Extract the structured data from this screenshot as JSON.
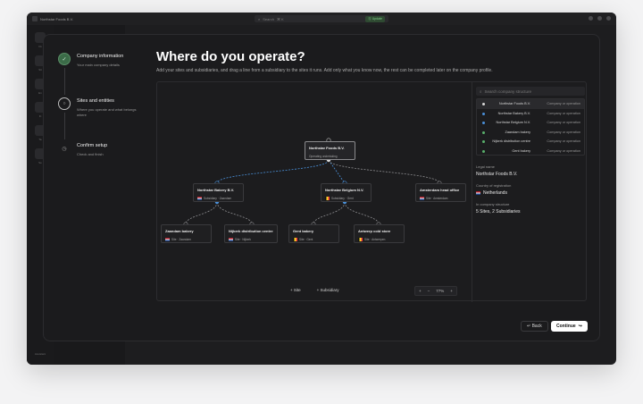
{
  "topbar": {
    "org_name": "Northstar Foods B.V.",
    "search_placeholder": "Search",
    "shortcut": "⌘ K",
    "badge": "Ⓢ Update"
  },
  "rail": {
    "items": [
      "Ov",
      "Sit",
      "En",
      "Fi",
      "Ta",
      "Se"
    ],
    "bottom_label": "Assistant"
  },
  "steps": [
    {
      "title": "Company information",
      "sub": "Your main company details",
      "state": "done",
      "marker": "✓"
    },
    {
      "title": "Sites and entities",
      "sub": "Where you operate and what belongs where",
      "state": "current",
      "marker": "○"
    },
    {
      "title": "Confirm setup",
      "sub": "Check and finish",
      "state": "todo",
      "marker": "◷"
    }
  ],
  "heading": "Where do you operate?",
  "description": "Add your sites and subsidiaries, and drag a line from a subsidiary to the sites it runs. Add only what you know now, the rest can be completed later on the company profile.",
  "nodes": {
    "root": {
      "name": "Northstar Foods B.V.",
      "meta": "Operating undertaking"
    },
    "sub1": {
      "name": "Northstar Bakery B.V.",
      "meta": "Subsidiary · Zaandam",
      "flag": "nl"
    },
    "sub2": {
      "name": "Northstar Belgium N.V.",
      "meta": "Subsidiary · Gent",
      "flag": "be"
    },
    "hq": {
      "name": "Amsterdam head office",
      "meta": "Site · Amsterdam",
      "flag": "nl"
    },
    "site1": {
      "name": "Zaandam bakery",
      "meta": "Site · Zaandam",
      "flag": "nl"
    },
    "site2": {
      "name": "Nijkerk distribution centre",
      "meta": "Site · Nijkerk",
      "flag": "nl"
    },
    "site3": {
      "name": "Gent bakery",
      "meta": "Site · Gent",
      "flag": "be"
    },
    "site4": {
      "name": "Antwerp cold store",
      "meta": "Site · Antwerpen",
      "flag": "be"
    }
  },
  "canvas_tools": {
    "add_site": "+ Site",
    "add_subsidiary": "+ Subsidiary"
  },
  "zoom": {
    "plus": "+",
    "minus": "−",
    "level": "77%",
    "fit": "+"
  },
  "side": {
    "search_placeholder": "Search company structure",
    "list": [
      {
        "name": "Northstar Foods B.V.",
        "type": "Company or operation",
        "dot": "#d8d8d8",
        "selected": true
      },
      {
        "name": "Northstar Bakery B.V.",
        "type": "Company or operation",
        "dot": "#4a90d9",
        "selected": false
      },
      {
        "name": "Northstar Belgium N.V.",
        "type": "Company or operation",
        "dot": "#4a90d9",
        "selected": false
      },
      {
        "name": "Zaandam bakery",
        "type": "Company or operation",
        "dot": "#59b06b",
        "selected": false
      },
      {
        "name": "Nijkerk distribution centre",
        "type": "Company or operation",
        "dot": "#59b06b",
        "selected": false
      },
      {
        "name": "Gent bakery",
        "type": "Company or operation",
        "dot": "#59b06b",
        "selected": false
      }
    ],
    "legal_name_label": "Legal name",
    "legal_name": "Northstar Foods B.V.",
    "country_label": "Country of registration",
    "country": "Netherlands",
    "structure_label": "In company structure",
    "structure": "5 Sites, 2 Subsidiaries"
  },
  "footer": {
    "back": "↵ Back",
    "continue": "Continue",
    "continue_icon": "↪"
  },
  "colors": {
    "accent": "#4a90d9",
    "done": "#3b6b48"
  }
}
